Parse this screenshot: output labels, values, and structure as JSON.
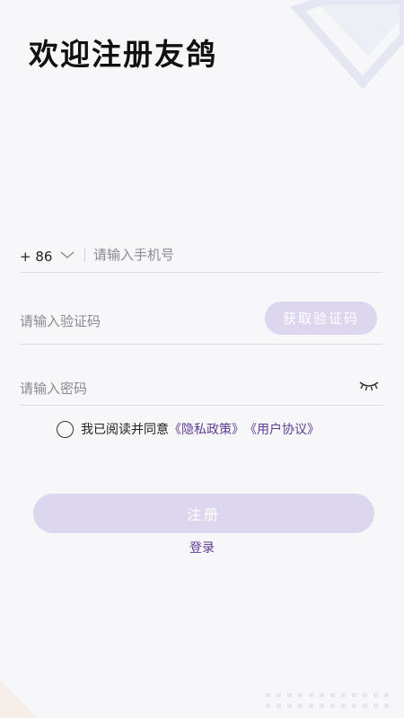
{
  "title": "欢迎注册友鸽",
  "phone": {
    "country_code": "+ 86",
    "placeholder": "请输入手机号"
  },
  "code": {
    "placeholder": "请输入验证码",
    "button_label": "获取验证码"
  },
  "password": {
    "placeholder": "请输入密码",
    "toggle_icon": "eye-closed-icon"
  },
  "agreement": {
    "prefix": "我已阅读并同意",
    "privacy_link": "《隐私政策》",
    "terms_link": "《用户协议》",
    "checked": false
  },
  "actions": {
    "register_label": "注册",
    "login_label": "登录"
  },
  "colors": {
    "background": "#f7f7f9",
    "accent": "#5e3d95",
    "button_disabled": "#ddd6ef",
    "decoration": "#e4e7f2"
  }
}
